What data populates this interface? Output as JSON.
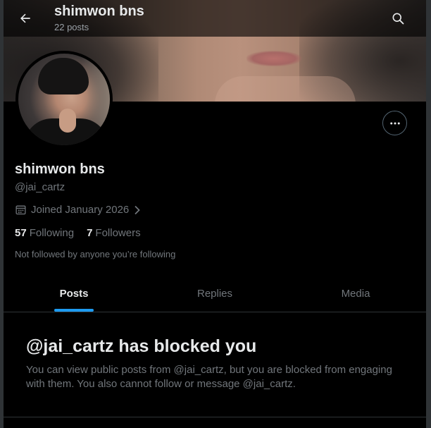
{
  "header": {
    "title": "shimwon bns",
    "post_count": "22 posts",
    "back_icon": "arrow-left-icon",
    "search_icon": "search-icon"
  },
  "profile": {
    "display_name": "shimwon bns",
    "handle": "@jai_cartz",
    "joined": "Joined January 2026",
    "following_count": "57",
    "following_label": "Following",
    "followers_count": "7",
    "followers_label": "Followers",
    "not_followed_note": "Not followed by anyone you’re following",
    "more_icon": "more-horizontal-icon"
  },
  "tabs": [
    {
      "label": "Posts",
      "active": true
    },
    {
      "label": "Replies",
      "active": false
    },
    {
      "label": "Media",
      "active": false
    }
  ],
  "blocked_notice": {
    "title": "@jai_cartz has blocked you",
    "body": "You can view public posts from @jai_cartz, but you are blocked from engaging with them. You also cannot follow or message @jai_cartz."
  },
  "colors": {
    "accent": "#1d9bf0",
    "background": "#000000",
    "primary_text": "#e7e9ea",
    "secondary_text": "#71767b",
    "border": "#2f3336"
  }
}
